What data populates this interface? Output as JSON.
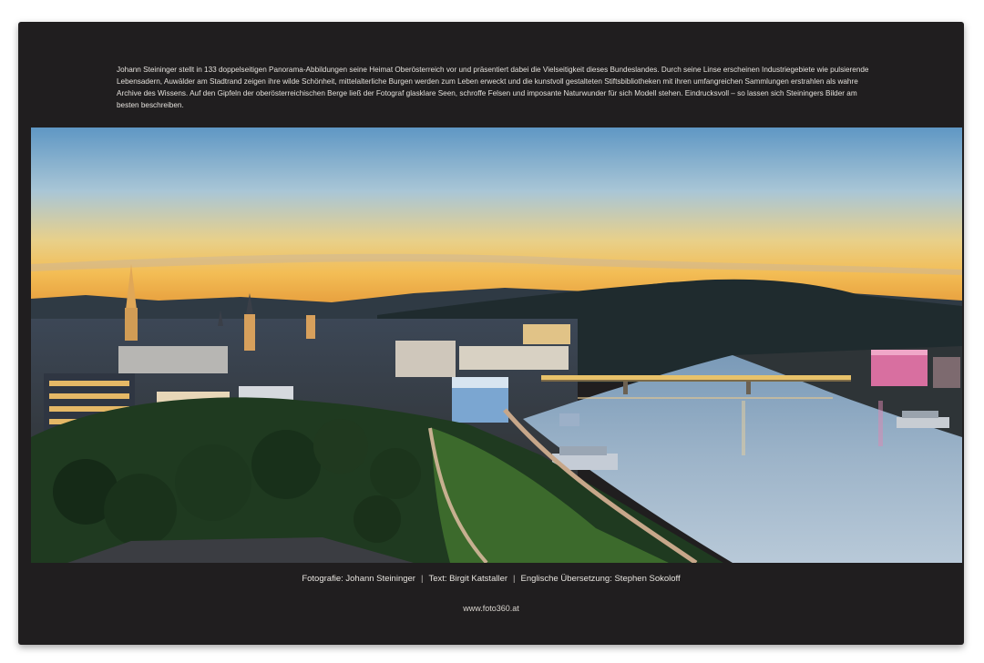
{
  "book": {
    "blurb": "Johann Steininger stellt in 133 doppelseitigen Panorama-Abbildungen seine Heimat Oberösterreich vor und präsentiert dabei die Vielseitigkeit dieses Bundeslandes. Durch seine Linse erscheinen Industriegebiete wie pulsierende Lebensadern, Auwälder am Stadtrand zeigen ihre wilde Schönheit, mittelalterliche Burgen werden zum Leben erweckt und die kunstvoll gestalteten Stiftsbibliotheken mit ihren umfangreichen Sammlungen erstrahlen als wahre Archive des Wissens. Auf den Gipfeln der oberösterreichischen Berge ließ der Fotograf glasklare Seen, schroffe Felsen und imposante Naturwunder für sich Modell stehen. Eindrucksvoll – so lassen sich Steiningers Bilder am besten beschreiben.",
    "credits": {
      "photo": "Fotografie: Johann Steininger",
      "text": "Text: Birgit Katstaller",
      "translation": "Englische Übersetzung: Stephen Sokoloff"
    },
    "separator": "|",
    "website": "www.foto360.at"
  },
  "colors": {
    "cover": "#201e1f",
    "sky_top": "#6fa3c9",
    "sky_horizon": "#f2c45a",
    "river": "#8aa6c0"
  }
}
